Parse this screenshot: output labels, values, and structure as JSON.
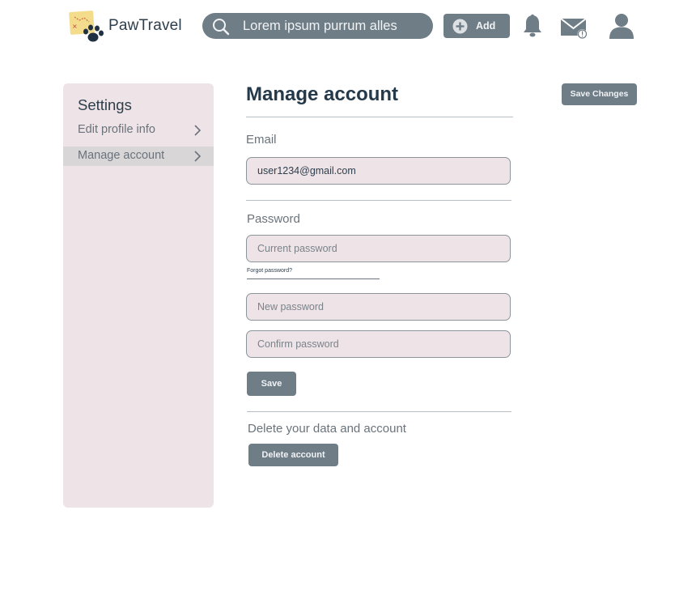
{
  "header": {
    "brand": "PawTravel",
    "search": {
      "value": "Lorem ipsum purrum alles"
    },
    "add_label": "Add"
  },
  "sidebar": {
    "title": "Settings",
    "items": [
      {
        "label": "Edit profile info",
        "active": false
      },
      {
        "label": "Manage account",
        "active": true
      }
    ]
  },
  "main": {
    "title": "Manage account",
    "save_changes_label": "Save Changes",
    "email": {
      "label": "Email",
      "value": "user1234@gmail.com"
    },
    "password": {
      "label": "Password",
      "current_placeholder": "Current password",
      "forgot_label": "Forgot password?",
      "new_placeholder": "New password",
      "confirm_placeholder": "Confirm password",
      "save_label": "Save"
    },
    "delete": {
      "label": "Delete your data and account",
      "button_label": "Delete account"
    }
  },
  "colors": {
    "button": "#6f7d87",
    "panel": "#eee3e6",
    "title": "#24394a"
  }
}
